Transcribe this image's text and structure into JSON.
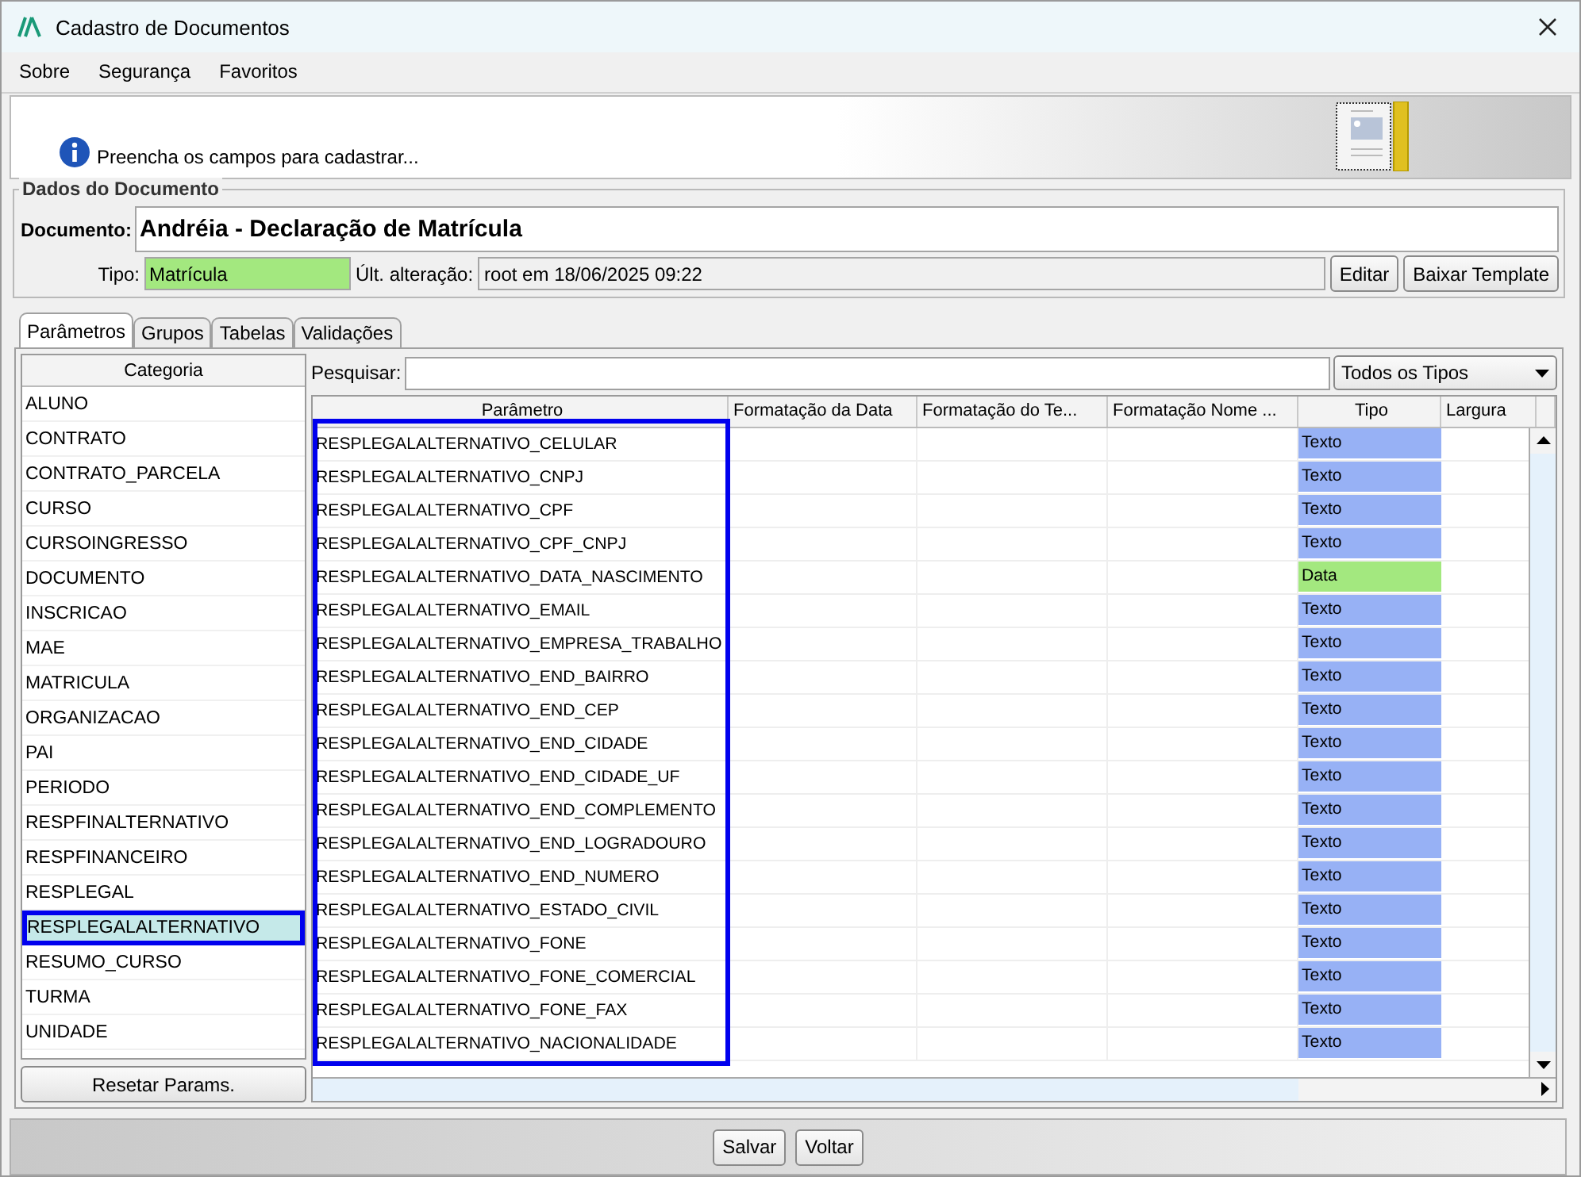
{
  "window": {
    "title": "Cadastro de Documentos"
  },
  "menu": [
    "Sobre",
    "Segurança",
    "Favoritos"
  ],
  "info_message": "Preencha os campos para cadastrar...",
  "document_group": {
    "title": "Dados do Documento",
    "documento_label": "Documento:",
    "documento_value": "Andréia - Declaração de Matrícula",
    "tipo_label": "Tipo:",
    "tipo_value": "Matrícula",
    "alteracao_label": "Últ. alteração:",
    "alteracao_value": "root em 18/06/2025 09:22",
    "buttons": [
      "Editar",
      "Baixar Template"
    ]
  },
  "tabs": [
    {
      "label": "Parâmetros",
      "selected": true
    },
    {
      "label": "Grupos",
      "selected": false
    },
    {
      "label": "Tabelas",
      "selected": false
    },
    {
      "label": "Validações",
      "selected": false
    }
  ],
  "categories": {
    "header": "Categoria",
    "items": [
      {
        "label": "ALUNO",
        "selected": false
      },
      {
        "label": "CONTRATO",
        "selected": false
      },
      {
        "label": "CONTRATO_PARCELA",
        "selected": false
      },
      {
        "label": "CURSO",
        "selected": false
      },
      {
        "label": "CURSOINGRESSO",
        "selected": false
      },
      {
        "label": "DOCUMENTO",
        "selected": false
      },
      {
        "label": "INSCRICAO",
        "selected": false
      },
      {
        "label": "MAE",
        "selected": false
      },
      {
        "label": "MATRICULA",
        "selected": false
      },
      {
        "label": "ORGANIZACAO",
        "selected": false
      },
      {
        "label": "PAI",
        "selected": false
      },
      {
        "label": "PERIODO",
        "selected": false
      },
      {
        "label": "RESPFINALTERNATIVO",
        "selected": false
      },
      {
        "label": "RESPFINANCEIRO",
        "selected": false
      },
      {
        "label": "RESPLEGAL",
        "selected": false
      },
      {
        "label": "RESPLEGALALTERNATIVO",
        "selected": true
      },
      {
        "label": "RESUMO_CURSO",
        "selected": false
      },
      {
        "label": "TURMA",
        "selected": false
      },
      {
        "label": "UNIDADE",
        "selected": false
      }
    ],
    "reset_button": "Resetar Params."
  },
  "search": {
    "label": "Pesquisar:"
  },
  "type_filter": {
    "value": "Todos os Tipos"
  },
  "table": {
    "columns": [
      "Parâmetro",
      "Formatação da Data",
      "Formatação do Te...",
      "Formatação Nome ...",
      "Tipo",
      "Largura"
    ],
    "rows": [
      {
        "parametro": "RESPLEGALALTERNATIVO_CELULAR",
        "tipo": "Texto",
        "color": "#97b1f5"
      },
      {
        "parametro": "RESPLEGALALTERNATIVO_CNPJ",
        "tipo": "Texto",
        "color": "#97b1f5"
      },
      {
        "parametro": "RESPLEGALALTERNATIVO_CPF",
        "tipo": "Texto",
        "color": "#97b1f5"
      },
      {
        "parametro": "RESPLEGALALTERNATIVO_CPF_CNPJ",
        "tipo": "Texto",
        "color": "#97b1f5"
      },
      {
        "parametro": "RESPLEGALALTERNATIVO_DATA_NASCIMENTO",
        "tipo": "Data",
        "color": "#a3e87f"
      },
      {
        "parametro": "RESPLEGALALTERNATIVO_EMAIL",
        "tipo": "Texto",
        "color": "#97b1f5"
      },
      {
        "parametro": "RESPLEGALALTERNATIVO_EMPRESA_TRABALHO",
        "tipo": "Texto",
        "color": "#97b1f5"
      },
      {
        "parametro": "RESPLEGALALTERNATIVO_END_BAIRRO",
        "tipo": "Texto",
        "color": "#97b1f5"
      },
      {
        "parametro": "RESPLEGALALTERNATIVO_END_CEP",
        "tipo": "Texto",
        "color": "#97b1f5"
      },
      {
        "parametro": "RESPLEGALALTERNATIVO_END_CIDADE",
        "tipo": "Texto",
        "color": "#97b1f5"
      },
      {
        "parametro": "RESPLEGALALTERNATIVO_END_CIDADE_UF",
        "tipo": "Texto",
        "color": "#97b1f5"
      },
      {
        "parametro": "RESPLEGALALTERNATIVO_END_COMPLEMENTO",
        "tipo": "Texto",
        "color": "#97b1f5"
      },
      {
        "parametro": "RESPLEGALALTERNATIVO_END_LOGRADOURO",
        "tipo": "Texto",
        "color": "#97b1f5"
      },
      {
        "parametro": "RESPLEGALALTERNATIVO_END_NUMERO",
        "tipo": "Texto",
        "color": "#97b1f5"
      },
      {
        "parametro": "RESPLEGALALTERNATIVO_ESTADO_CIVIL",
        "tipo": "Texto",
        "color": "#97b1f5"
      },
      {
        "parametro": "RESPLEGALALTERNATIVO_FONE",
        "tipo": "Texto",
        "color": "#97b1f5"
      },
      {
        "parametro": "RESPLEGALALTERNATIVO_FONE_COMERCIAL",
        "tipo": "Texto",
        "color": "#97b1f5"
      },
      {
        "parametro": "RESPLEGALALTERNATIVO_FONE_FAX",
        "tipo": "Texto",
        "color": "#97b1f5"
      },
      {
        "parametro": "RESPLEGALALTERNATIVO_NACIONALIDADE",
        "tipo": "Texto",
        "color": "#97b1f5"
      }
    ]
  },
  "footer_buttons": [
    "Salvar",
    "Voltar"
  ]
}
